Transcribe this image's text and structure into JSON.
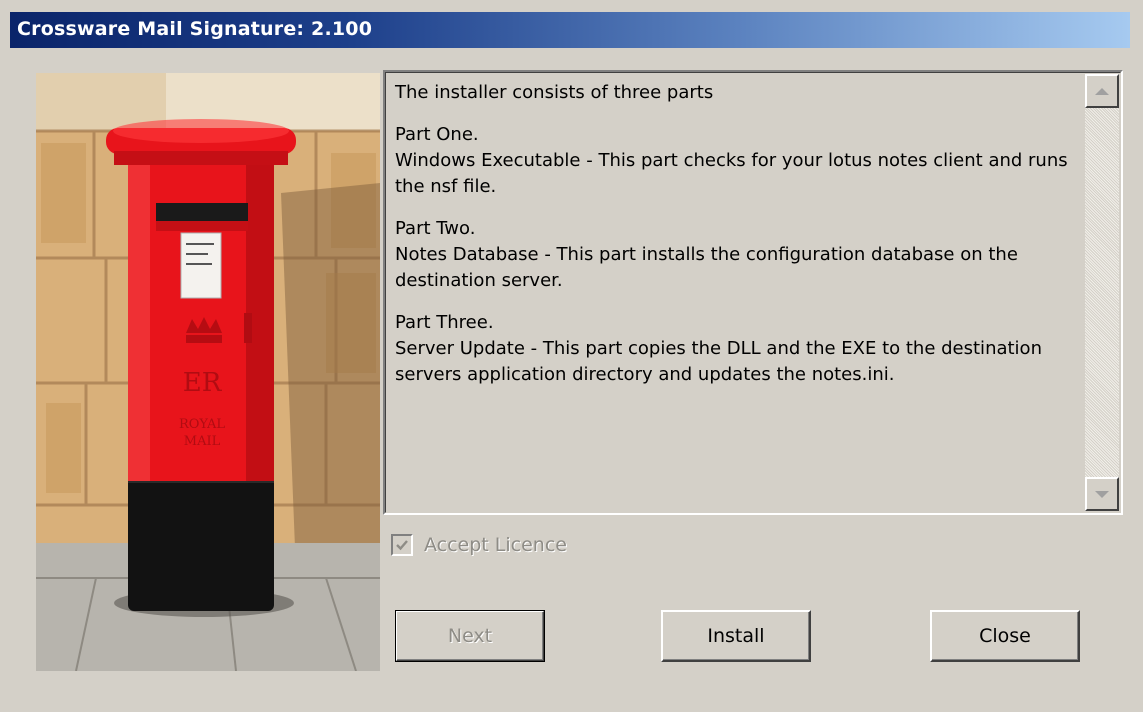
{
  "window": {
    "title": "Crossware Mail Signature: 2.100"
  },
  "image": {
    "icon": "postbox-photo",
    "alt": "Red pillar post box"
  },
  "info_text": {
    "intro": "The installer consists of three parts",
    "part1_heading": "Part One.",
    "part1_body": "Windows Executable - This part checks for your lotus notes client and runs the nsf file.",
    "part2_heading": "Part Two.",
    "part2_body": "Notes Database - This part installs the configuration database on the destination server.",
    "part3_heading": "Part Three.",
    "part3_body": "Server Update - This part copies the DLL and the EXE to the destination servers application directory and updates the notes.ini."
  },
  "scrollbar": {
    "up_icon": "scroll-up-arrow-icon",
    "down_icon": "scroll-down-arrow-icon"
  },
  "licence": {
    "label": "Accept Licence",
    "checked": true,
    "disabled": true
  },
  "buttons": {
    "next": "Next",
    "install": "Install",
    "close": "Close"
  },
  "colors": {
    "titlebar_start": "#0a246a",
    "titlebar_end": "#a6caf0",
    "window_bg": "#d4d0c8",
    "postbox_red": "#e8141b"
  }
}
